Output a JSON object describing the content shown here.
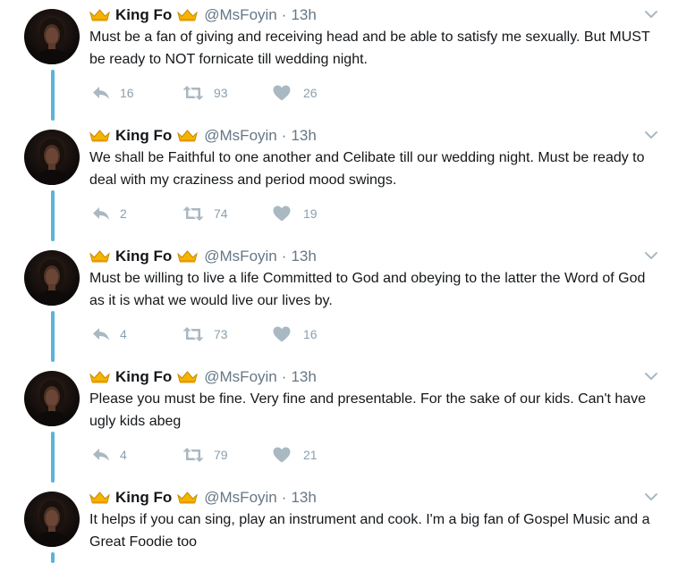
{
  "tweets": [
    {
      "name": "King Fo",
      "handle": "@MsFoyin",
      "time": "13h",
      "text": "Must be a fan of giving and receiving head and be able to satisfy me sexually. But MUST be ready to NOT fornicate till wedding night.",
      "replies": "16",
      "retweets": "93",
      "likes": "26"
    },
    {
      "name": "King Fo",
      "handle": "@MsFoyin",
      "time": "13h",
      "text": "We shall be Faithful to one another and Celibate till our wedding night. Must be ready to deal with my craziness and period mood swings.",
      "replies": "2",
      "retweets": "74",
      "likes": "19"
    },
    {
      "name": "King Fo",
      "handle": "@MsFoyin",
      "time": "13h",
      "text": "Must be willing to live a life Committed to God and obeying to the latter the Word of God as it is what we would live our lives by.",
      "replies": "4",
      "retweets": "73",
      "likes": "16"
    },
    {
      "name": "King Fo",
      "handle": "@MsFoyin",
      "time": "13h",
      "text": "Please you must be fine. Very fine and presentable. For the sake of our kids. Can't have ugly kids abeg",
      "replies": "4",
      "retweets": "79",
      "likes": "21"
    },
    {
      "name": "King Fo",
      "handle": "@MsFoyin",
      "time": "13h",
      "text": "It helps if you can sing, play an instrument and cook. I'm a big fan of Gospel Music and a Great Foodie too"
    }
  ],
  "separator": "·",
  "icons": {
    "name_emoji": "crown-icon",
    "reply": "reply-icon",
    "retweet": "retweet-icon",
    "like": "heart-icon",
    "menu": "chevron-down-icon"
  },
  "colors": {
    "thread_line": "#5ab4d8",
    "text": "#14171a",
    "secondary": "#657786",
    "action_icon": "#aab8c2"
  }
}
